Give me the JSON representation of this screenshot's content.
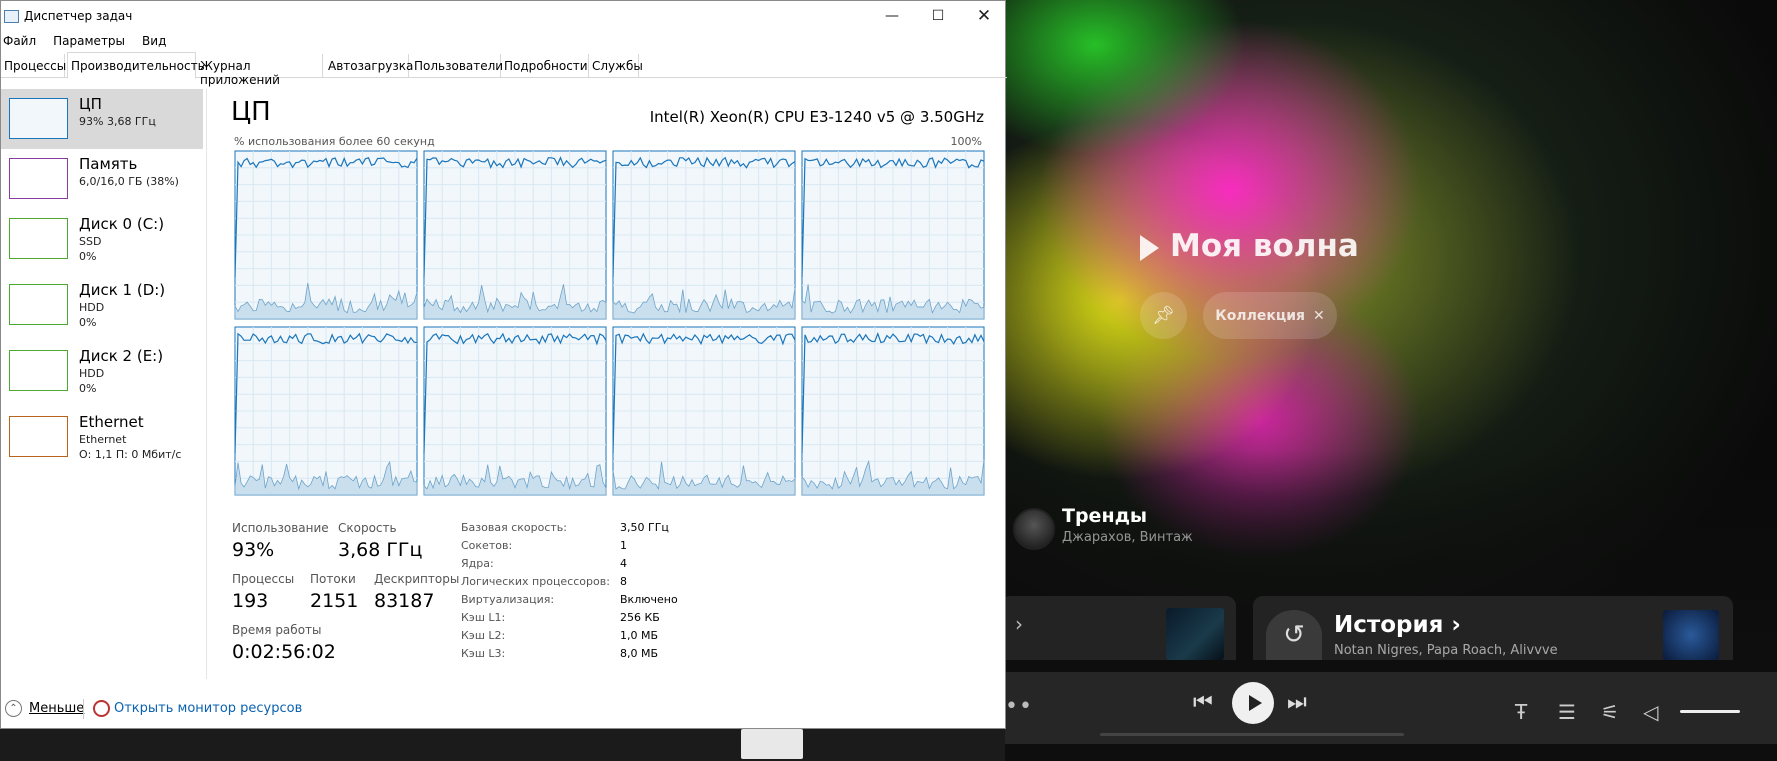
{
  "task_manager": {
    "title": "Диспетчер задач",
    "menu": [
      "Файл",
      "Параметры",
      "Вид"
    ],
    "tabs": [
      "Процессы",
      "Производительность",
      "Журнал приложений",
      "Автозагрузка",
      "Пользователи",
      "Подробности",
      "Службы"
    ],
    "active_tab": "Производительность",
    "sidebar": [
      {
        "name": "ЦП",
        "line1": "93% 3,68 ГГц",
        "line2": "",
        "color": "#1a75bb"
      },
      {
        "name": "Память",
        "line1": "6,0/16,0 ГБ (38%)",
        "line2": "",
        "color": "#8b3aa0"
      },
      {
        "name": "Диск 0 (C:)",
        "line1": "SSD",
        "line2": "0%",
        "color": "#4da830"
      },
      {
        "name": "Диск 1 (D:)",
        "line1": "HDD",
        "line2": "0%",
        "color": "#4da830"
      },
      {
        "name": "Диск 2 (E:)",
        "line1": "HDD",
        "line2": "0%",
        "color": "#4da830"
      },
      {
        "name": "Ethernet",
        "line1": "Ethernet",
        "line2": "О: 1,1 П: 0 Мбит/с",
        "color": "#b8641e"
      }
    ],
    "cpu": {
      "heading": "ЦП",
      "model": "Intel(R) Xeon(R) CPU E3-1240 v5 @ 3.50GHz",
      "graph_label": "% использования более 60 секунд",
      "graph_max": "100%",
      "logical_processor_graphs": 8,
      "stats": {
        "usage_label": "Использование",
        "usage_value": "93%",
        "speed_label": "Скорость",
        "speed_value": "3,68 ГГц",
        "processes_label": "Процессы",
        "processes_value": "193",
        "threads_label": "Потоки",
        "threads_value": "2151",
        "handles_label": "Дескрипторы",
        "handles_value": "83187",
        "uptime_label": "Время работы",
        "uptime_value": "0:02:56:02"
      },
      "specs": [
        {
          "label": "Базовая скорость:",
          "value": "3,50 ГГц"
        },
        {
          "label": "Сокетов:",
          "value": "1"
        },
        {
          "label": "Ядра:",
          "value": "4"
        },
        {
          "label": "Логических процессоров:",
          "value": "8"
        },
        {
          "label": "Виртуализация:",
          "value": "Включено"
        },
        {
          "label": "Кэш L1:",
          "value": "256 КБ"
        },
        {
          "label": "Кэш L2:",
          "value": "1,0 МБ"
        },
        {
          "label": "Кэш L3:",
          "value": "8,0 МБ"
        }
      ]
    },
    "footer": {
      "less_label": "Меньше",
      "resmon_label": "Открыть монитор ресурсов"
    }
  },
  "music_app": {
    "wave_title": "Моя волна",
    "collection_label": "Коллекция",
    "trends_title": "Тренды",
    "trends_subtitle": "Джарахов, Винтаж",
    "history_title": "История",
    "history_subtitle": "Notan Nigres, Papa Roach, Alivvve"
  },
  "colors": {
    "cpu_line": "#1a75bb",
    "cpu_fill": "#f1f7fb",
    "grid": "#d9e8f3"
  }
}
